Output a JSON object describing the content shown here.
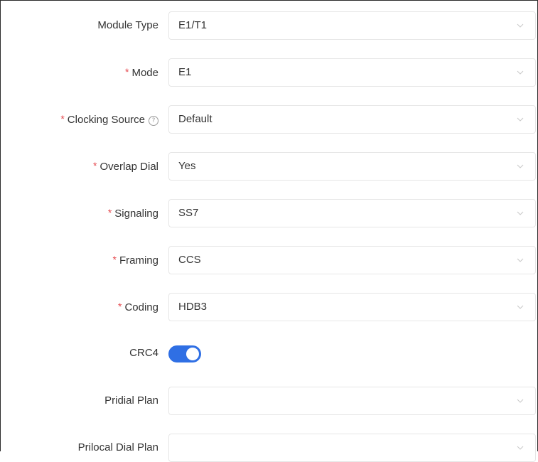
{
  "form": {
    "module_type": {
      "label": "Module Type",
      "value": "E1/T1",
      "required": false
    },
    "mode": {
      "label": "Mode",
      "value": "E1",
      "required": true
    },
    "clocking_source": {
      "label": "Clocking Source",
      "value": "Default",
      "required": true,
      "help_icon": "question-circle-icon"
    },
    "overlap_dial": {
      "label": "Overlap Dial",
      "value": "Yes",
      "required": true
    },
    "signaling": {
      "label": "Signaling",
      "value": "SS7",
      "required": true
    },
    "framing": {
      "label": "Framing",
      "value": "CCS",
      "required": true
    },
    "coding": {
      "label": "Coding",
      "value": "HDB3",
      "required": true
    },
    "crc4": {
      "label": "CRC4",
      "enabled": true
    },
    "pridial_plan": {
      "label": "Pridial Plan",
      "value": ""
    },
    "prilocal_dial_plan": {
      "label": "Prilocal Dial Plan",
      "value": ""
    }
  },
  "colors": {
    "required_mark": "#e5484d",
    "switch_on": "#2f6fe4",
    "border": "#e6e6e6"
  },
  "required_mark": "*",
  "help_glyph": "?"
}
